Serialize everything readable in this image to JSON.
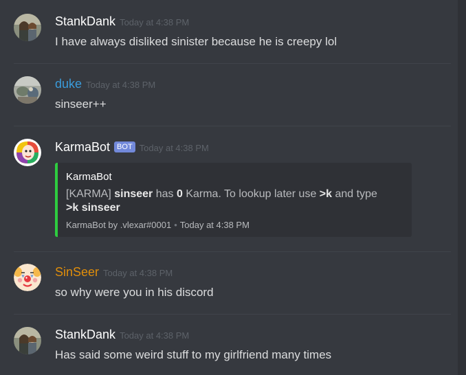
{
  "messages": [
    {
      "username": "StankDank",
      "timestamp": "Today at 4:38 PM",
      "text": "I have always disliked sinister because he is creepy lol",
      "avatar": "group-photo-avatar"
    },
    {
      "username": "duke",
      "timestamp": "Today at 4:38 PM",
      "text": "sinseer++",
      "username_color": "#3a9bda",
      "avatar": "photo-avatar"
    },
    {
      "username": "KarmaBot",
      "bot_badge": "BOT",
      "timestamp": "Today at 4:38 PM",
      "avatar": "abstract-face-avatar",
      "embed": {
        "title": "KarmaBot",
        "desc_prefix": "[KARMA] ",
        "desc_user": "sinseer",
        "desc_mid1": " has ",
        "desc_count": "0",
        "desc_mid2": " Karma. To lookup later use ",
        "desc_cmd": ">k",
        "desc_mid3": " and type ",
        "desc_full_cmd": ">k sinseer",
        "footer_author": "KarmaBot by .vlexar#0001",
        "footer_separator": "•",
        "footer_time": "Today at 4:38 PM",
        "border_color": "#2ecc40"
      }
    },
    {
      "username": "SinSeer",
      "timestamp": "Today at 4:38 PM",
      "text": "so why were you in his discord",
      "username_color": "#e08e0b",
      "avatar": "clown-avatar"
    },
    {
      "username": "StankDank",
      "timestamp": "Today at 4:38 PM",
      "text": "Has said some weird stuff to my girlfriend many times",
      "avatar": "group-photo-avatar"
    }
  ],
  "colors": {
    "background": "#36393f",
    "bot_tag": "#7289da",
    "timestamp": "#5d6269"
  }
}
